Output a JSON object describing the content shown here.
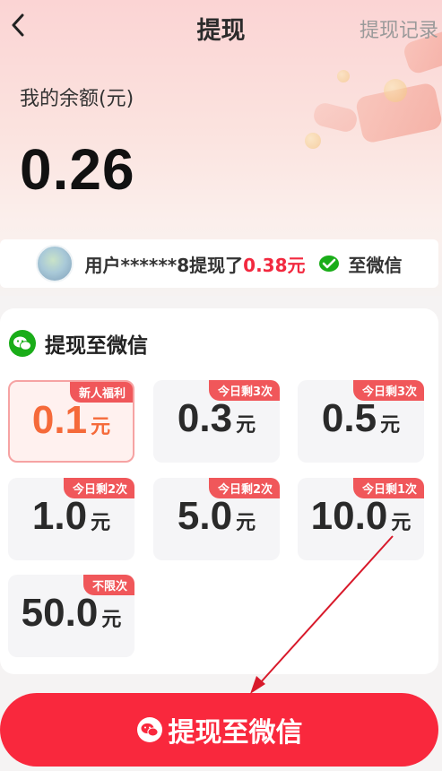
{
  "header": {
    "title": "提现",
    "record_link": "提现记录"
  },
  "balance": {
    "label": "我的余额(元)",
    "value": "0.26"
  },
  "notice": {
    "text_prefix": "用户******8提现了",
    "amount": "0.38元",
    "destination": "至微信"
  },
  "panel": {
    "title": "提现至微信",
    "unit": "元",
    "options": [
      {
        "amount": "0.1",
        "badge": "新人福利",
        "selected": true
      },
      {
        "amount": "0.3",
        "badge": "今日剩3次",
        "selected": false
      },
      {
        "amount": "0.5",
        "badge": "今日剩3次",
        "selected": false
      },
      {
        "amount": "1.0",
        "badge": "今日剩2次",
        "selected": false
      },
      {
        "amount": "5.0",
        "badge": "今日剩2次",
        "selected": false
      },
      {
        "amount": "10.0",
        "badge": "今日剩1次",
        "selected": false
      },
      {
        "amount": "50.0",
        "badge": "不限次",
        "selected": false
      }
    ]
  },
  "cta": {
    "label": "提现至微信"
  },
  "colors": {
    "accent": "#f9283d",
    "selected_amount": "#f56a3a",
    "badge": "#f0575a",
    "wechat": "#1aad19"
  }
}
